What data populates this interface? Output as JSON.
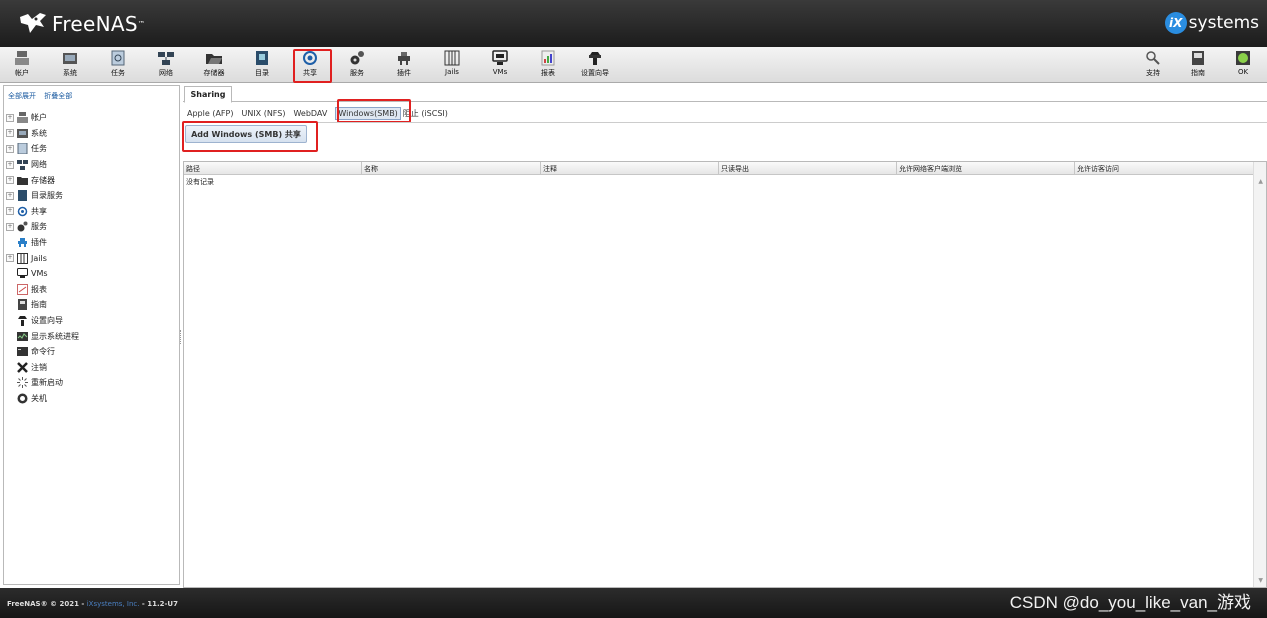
{
  "header": {
    "logo_text": "FreeNAS",
    "logo_mark": "™",
    "vendor_mark": "iX",
    "vendor_text": "systems"
  },
  "toolbar": {
    "items": [
      {
        "label": "帐户",
        "icon": "users-icon"
      },
      {
        "label": "系统",
        "icon": "system-icon"
      },
      {
        "label": "任务",
        "icon": "tasks-icon"
      },
      {
        "label": "网络",
        "icon": "network-icon"
      },
      {
        "label": "存储器",
        "icon": "storage-icon"
      },
      {
        "label": "目录",
        "icon": "directory-icon"
      },
      {
        "label": "共享",
        "icon": "sharing-icon"
      },
      {
        "label": "服务",
        "icon": "services-icon"
      },
      {
        "label": "插件",
        "icon": "plugins-icon"
      },
      {
        "label": "Jails",
        "icon": "jails-icon"
      },
      {
        "label": "VMs",
        "icon": "vms-icon"
      },
      {
        "label": "报表",
        "icon": "reporting-icon"
      },
      {
        "label": "设置向导",
        "icon": "wizard-icon"
      }
    ],
    "right_items": [
      {
        "label": "支持",
        "icon": "support-icon"
      },
      {
        "label": "指南",
        "icon": "guide-icon"
      },
      {
        "label": "OK",
        "icon": "alert-ok-icon"
      }
    ]
  },
  "left": {
    "expand_all": "全部展开",
    "collapse_all": "折叠全部",
    "tree": [
      {
        "label": "帐户",
        "expandable": true
      },
      {
        "label": "系统",
        "expandable": true
      },
      {
        "label": "任务",
        "expandable": true
      },
      {
        "label": "网络",
        "expandable": true
      },
      {
        "label": "存储器",
        "expandable": true
      },
      {
        "label": "目录服务",
        "expandable": true
      },
      {
        "label": "共享",
        "expandable": true
      },
      {
        "label": "服务",
        "expandable": true
      },
      {
        "label": "插件",
        "expandable": false
      },
      {
        "label": "Jails",
        "expandable": true
      },
      {
        "label": "VMs",
        "expandable": false
      },
      {
        "label": "报表",
        "expandable": false
      },
      {
        "label": "指南",
        "expandable": false
      },
      {
        "label": "设置向导",
        "expandable": false
      },
      {
        "label": "显示系统进程",
        "expandable": false
      },
      {
        "label": "命令行",
        "expandable": false
      },
      {
        "label": "注销",
        "expandable": false
      },
      {
        "label": "重新启动",
        "expandable": false
      },
      {
        "label": "关机",
        "expandable": false
      }
    ]
  },
  "main": {
    "tab_label": "Sharing",
    "subtabs": [
      "Apple (AFP)",
      "UNIX (NFS)",
      "WebDAV",
      "Windows(SMB)",
      "阻止 (iSCSI)"
    ],
    "active_subtab": "Windows(SMB)",
    "add_button": "Add Windows (SMB) 共享",
    "columns": [
      "路径",
      "名称",
      "注释",
      "只读导出",
      "允许网络客户端浏览",
      "允许访客访问"
    ],
    "empty_text": "没有记录"
  },
  "footer": {
    "copyright": "FreeNAS® © 2021 - ",
    "company": "iXsystems, Inc.",
    "version": " - 11.2-U7",
    "watermark": "CSDN @do_you_like_van_游戏"
  },
  "colors": {
    "highlight": "#e02020",
    "link": "#1a5aa0",
    "header_bg": "#2a2a2a"
  }
}
